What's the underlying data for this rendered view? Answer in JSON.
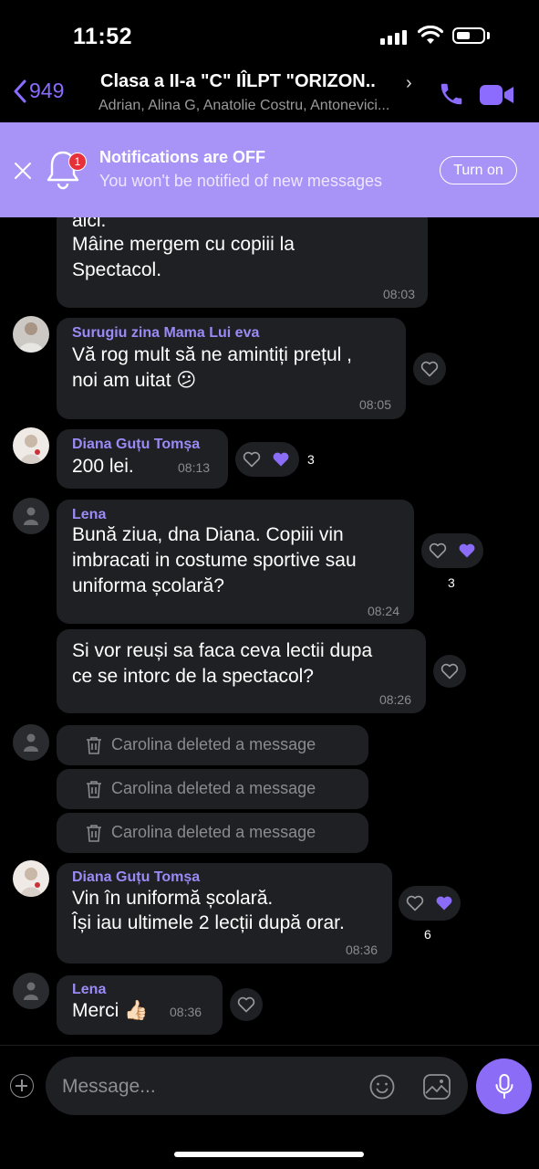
{
  "status_bar": {
    "time": "11:52"
  },
  "header": {
    "back_count": "949",
    "title": "Clasa a II-a \"C\" IÎLPT \"ORIZON..",
    "chevron": "›",
    "subtitle": "Adrian, Alina G, Anatolie Costru, Antonevici..."
  },
  "banner": {
    "badge": "1",
    "title": "Notifications are OFF",
    "subtitle": "You won't be notified of new messages",
    "button": "Turn on"
  },
  "messages": [
    {
      "text_line0": "aici.",
      "text_line1": "Mâine mergem cu copiii la",
      "text_line2": "Spectacol.",
      "time": "08:03"
    },
    {
      "sender": "Surugiu zina Mama Lui eva",
      "text_line1": "Vă rog mult să ne amintiți prețul ,",
      "text_line2": "noi am uitat 😕",
      "time": "08:05"
    },
    {
      "sender": "Diana Guțu Tomșa",
      "text": "200 lei.",
      "time": "08:13",
      "reaction_count": "3"
    },
    {
      "sender": "Lena",
      "text_line1": "Bună ziua, dna Diana. Copiii vin",
      "text_line2": "imbracati in costume sportive sau",
      "text_line3": "uniforma școlară?",
      "time": "08:24",
      "reaction_count": "3"
    },
    {
      "text_line1": "Si vor reuși sa faca ceva lectii dupa",
      "text_line2": "ce se intorc de la spectacol?",
      "time": "08:26"
    },
    {
      "deleted_1": "Carolina deleted a message",
      "deleted_2": "Carolina deleted a message",
      "deleted_3": "Carolina deleted a message"
    },
    {
      "sender": "Diana Guțu Tomșa",
      "text_line1": "Vin în uniformă școlară.",
      "text_line2": "Își iau ultimele 2 lecții după orar.",
      "time": "08:36",
      "reaction_count": "6"
    },
    {
      "sender": "Lena",
      "text": "Merci 👍🏻",
      "time": "08:36"
    }
  ],
  "composer": {
    "placeholder": "Message..."
  },
  "icons": {
    "back": "chevron-left-icon",
    "call": "phone-icon",
    "video": "video-camera-icon",
    "close": "close-icon",
    "bell": "bell-icon",
    "heart": "heart-icon",
    "trash": "trash-icon",
    "plus": "plus-icon",
    "emoji": "emoji-icon",
    "sticker": "sticker-icon",
    "mic": "microphone-icon"
  },
  "colors": {
    "accent": "#8b6cf6",
    "banner": "#a894f7",
    "bubble": "#1f2024",
    "background": "#000000",
    "badge": "#e6313b"
  }
}
